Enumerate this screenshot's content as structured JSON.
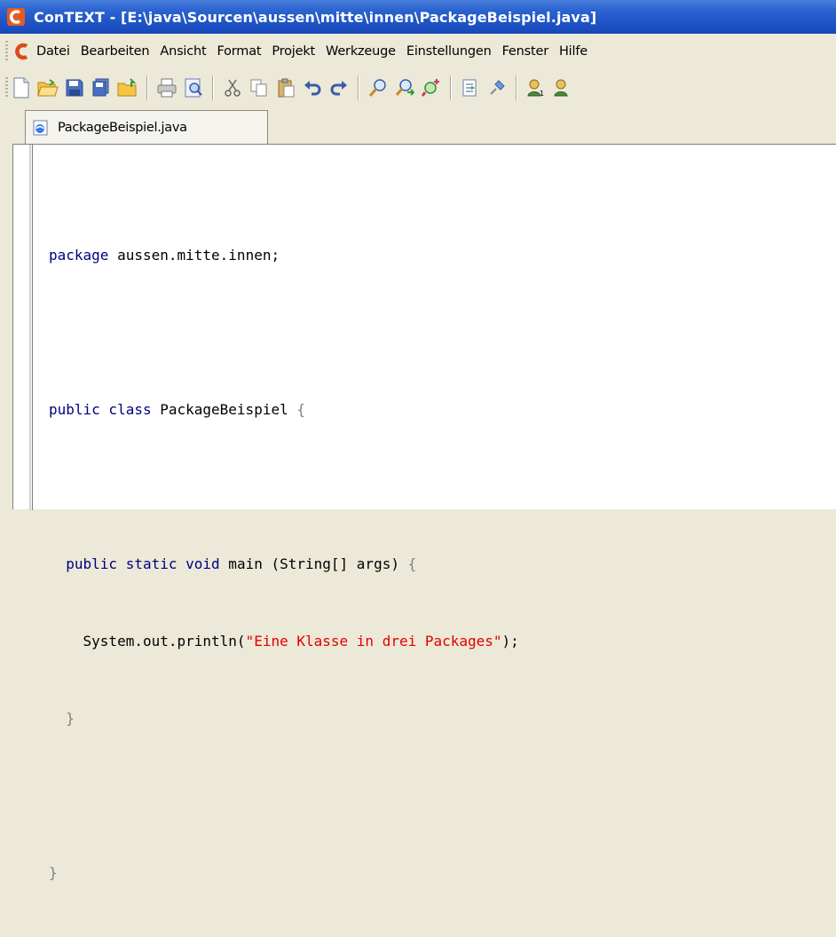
{
  "window": {
    "title": "ConTEXT - [E:\\java\\Sourcen\\aussen\\mitte\\innen\\PackageBeispiel.java]",
    "app_icon": "context-logo-icon"
  },
  "menubar": {
    "items": [
      "Datei",
      "Bearbeiten",
      "Ansicht",
      "Format",
      "Projekt",
      "Werkzeuge",
      "Einstellungen",
      "Fenster",
      "Hilfe"
    ]
  },
  "toolbar": {
    "buttons": [
      "new-file-icon",
      "open-folder-icon",
      "save-icon",
      "save-all-icon",
      "open-dir-icon",
      "print-icon",
      "print-preview-icon",
      "cut-icon",
      "copy-icon",
      "paste-icon",
      "undo-icon",
      "redo-icon",
      "find-icon",
      "find-next-icon",
      "replace-icon",
      "goto-icon",
      "pin-icon",
      "user-tool1-icon",
      "user-tool2-icon"
    ]
  },
  "tabs": [
    {
      "label": "PackageBeispiel.java",
      "active": true,
      "icon": "java-file-icon"
    }
  ],
  "editor": {
    "lines": [
      {
        "kw1": "package",
        "rest": " aussen.mitte.innen;"
      },
      {
        "text": ""
      },
      {
        "kw1": "public",
        "kw2": " class",
        "rest": " PackageBeispiel ",
        "brace": "{"
      },
      {
        "text": ""
      },
      {
        "indent": "  ",
        "kw1": "public",
        "kw2": " static",
        "kw3": " void",
        "rest": " main (String[] args) ",
        "brace": "{"
      },
      {
        "indent": "    ",
        "pre": "System.out.println(",
        "str": "\"Eine Klasse in drei Packages\"",
        "post": ");"
      },
      {
        "indent": "  ",
        "brace": "}"
      },
      {
        "text": ""
      },
      {
        "brace": "}"
      }
    ]
  },
  "colors": {
    "keyword": "#000080",
    "string": "#e00000",
    "brace": "#808080",
    "titlebar": "#1e53c4"
  }
}
